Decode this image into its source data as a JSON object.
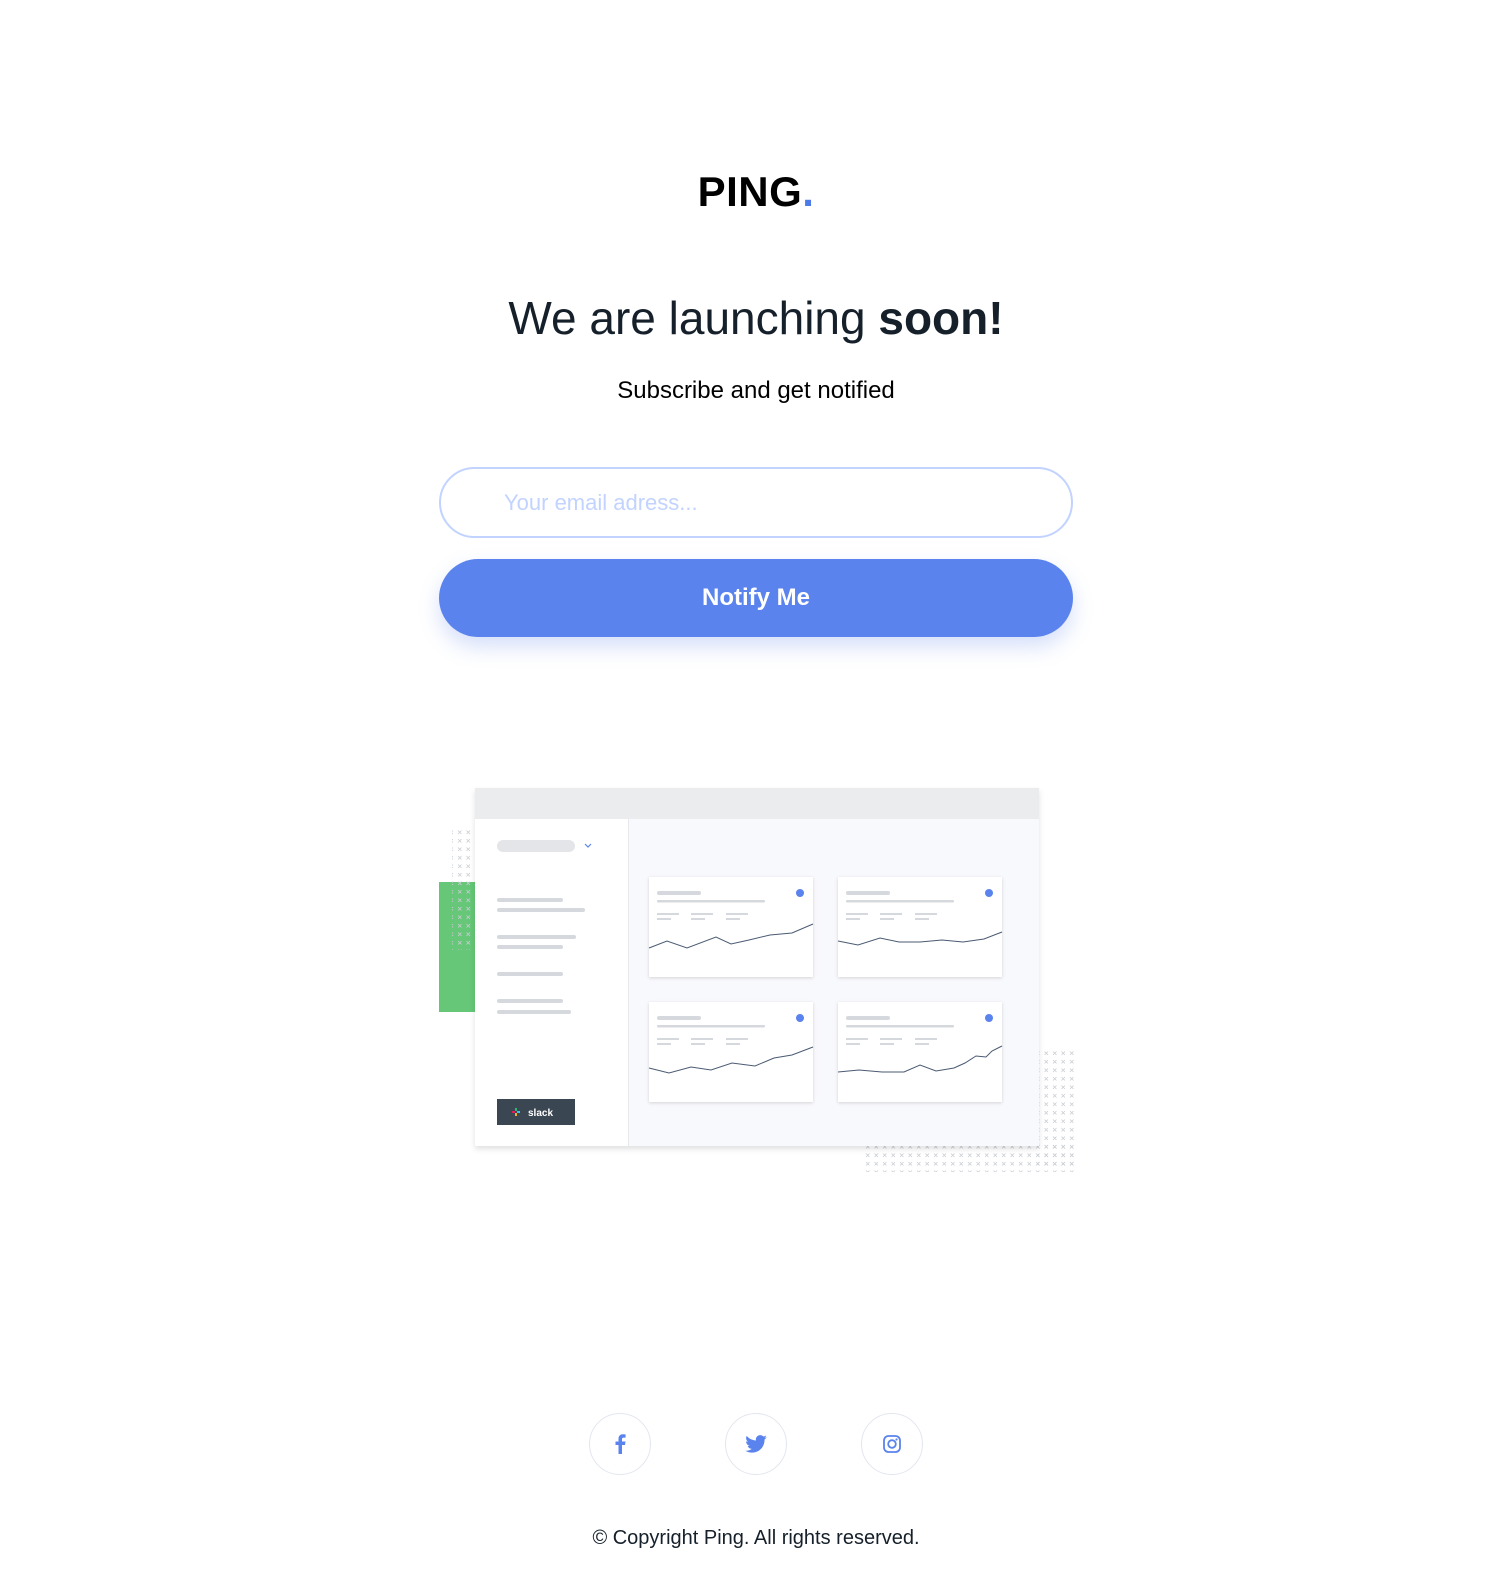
{
  "brand": {
    "name": "PING",
    "dot": ".",
    "accent_color": "#4c7ae7"
  },
  "hero": {
    "headline_light": "We are launching ",
    "headline_bold": "soon!",
    "subtitle": "Subscribe and get notified"
  },
  "form": {
    "email_placeholder": "Your email adress...",
    "email_value": "",
    "button_label": "Notify Me",
    "button_color": "#5b83ed",
    "input_border_color": "#c2d3ff"
  },
  "illustration": {
    "sidebar_badge": "slack"
  },
  "social": [
    {
      "name": "facebook-icon",
      "label": "Facebook"
    },
    {
      "name": "twitter-icon",
      "label": "Twitter"
    },
    {
      "name": "instagram-icon",
      "label": "Instagram"
    }
  ],
  "footer": {
    "copyright": "© Copyright Ping. All rights reserved."
  }
}
